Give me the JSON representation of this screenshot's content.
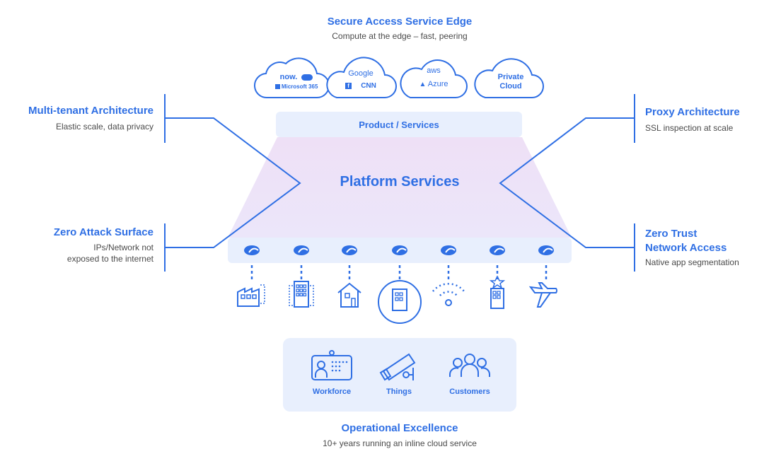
{
  "top": {
    "title": "Secure Access Service Edge",
    "subtitle": "Compute at the edge – fast, peering"
  },
  "clouds": [
    {
      "name": "saas-cloud",
      "lines": [
        "now.",
        "Microsoft 365"
      ],
      "logos": [
        "servicenow-logo",
        "salesforce-logo",
        "microsoft-logo"
      ]
    },
    {
      "name": "consumer-cloud",
      "lines": [
        "Google",
        "CNN"
      ],
      "logos": [
        "google-logo",
        "facebook-logo",
        "cnn-logo"
      ]
    },
    {
      "name": "iaas-cloud",
      "lines": [
        "aws",
        "Azure"
      ],
      "logos": [
        "aws-logo",
        "azure-logo"
      ]
    },
    {
      "name": "private-cloud",
      "lines": [
        "Private",
        "Cloud"
      ],
      "logos": []
    }
  ],
  "center": {
    "product_services": "Product / Services",
    "platform_services": "Platform Services"
  },
  "left": [
    {
      "title": "Multi-tenant Architecture",
      "subtitle": [
        "Elastic scale, data privacy"
      ]
    },
    {
      "title": "Zero Attack Surface",
      "subtitle": [
        "IPs/Network not",
        "exposed to the internet"
      ]
    }
  ],
  "right": [
    {
      "title": [
        "Proxy Architecture"
      ],
      "subtitle": "SSL inspection at scale"
    },
    {
      "title": [
        "Zero Trust",
        "Network Access"
      ],
      "subtitle": "Native app segmentation"
    }
  ],
  "locations": [
    {
      "icon": "factory-icon"
    },
    {
      "icon": "office-building-icon"
    },
    {
      "icon": "home-icon"
    },
    {
      "icon": "headquarters-icon"
    },
    {
      "icon": "wifi-hotspot-icon"
    },
    {
      "icon": "hotel-icon"
    },
    {
      "icon": "airplane-icon"
    }
  ],
  "operations": {
    "items": [
      {
        "label": "Workforce",
        "icon": "badge-icon"
      },
      {
        "label": "Things",
        "icon": "camera-icon"
      },
      {
        "label": "Customers",
        "icon": "users-icon"
      }
    ],
    "title": "Operational Excellence",
    "subtitle": "10+ years running an inline cloud service"
  },
  "colors": {
    "accent": "#2f6fe4",
    "panel": "#e8effd",
    "platform": "#efe3f7",
    "text_gray": "#4a4a4a"
  }
}
